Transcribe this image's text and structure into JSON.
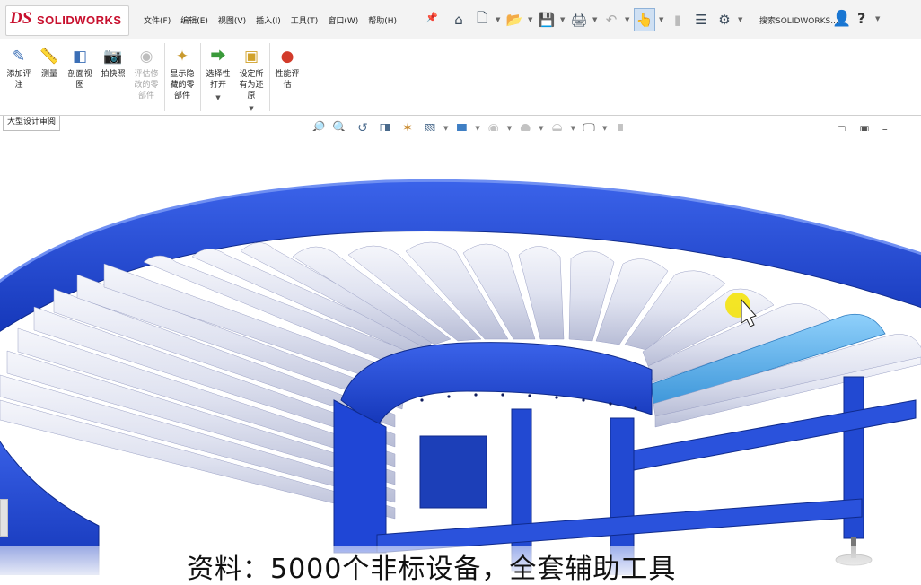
{
  "app": {
    "logo_mark": "DS",
    "logo_text": "SOLIDWORKS"
  },
  "menu": [
    "文件(F)",
    "编辑(E)",
    "视图(V)",
    "插入(I)",
    "工具(T)",
    "窗口(W)",
    "帮助(H)"
  ],
  "search": {
    "label": "搜索SOLIDWORKS..."
  },
  "ribbon": {
    "buttons": [
      {
        "line1": "添加评",
        "line2": "注"
      },
      {
        "line1": "测量",
        "line2": ""
      },
      {
        "line1": "剖面视",
        "line2": "图"
      },
      {
        "line1": "拍快照",
        "line2": ""
      },
      {
        "line1": "评估修",
        "line2": "改的零",
        "line3": "部件"
      },
      {
        "line1": "显示隐",
        "line2": "藏的零",
        "line3": "部件"
      },
      {
        "line1": "选择性",
        "line2": "打开"
      },
      {
        "line1": "设定所",
        "line2": "有为还",
        "line3": "原"
      },
      {
        "line1": "性能评",
        "line2": "估"
      }
    ]
  },
  "command_tab": "大型设计审阅",
  "caption": "资料：5000个非标设备，全套辅助工具",
  "colors": {
    "frame_blue": "#1f46d6",
    "roller": "#e4e6f2",
    "selected_roller": "#5db4f0",
    "logo_red": "#c8102e"
  }
}
